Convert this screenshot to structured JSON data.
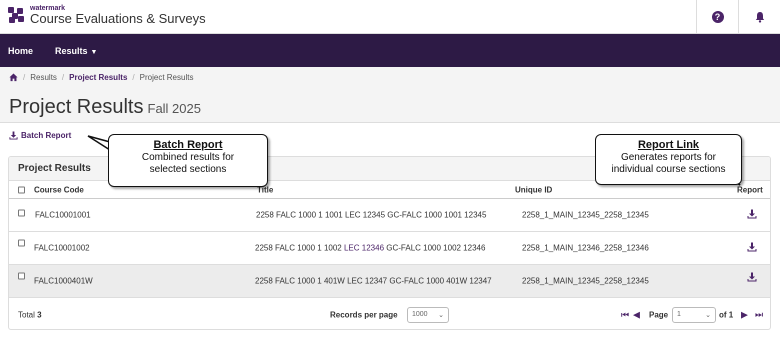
{
  "app": {
    "brand_small": "watermark",
    "brand_name": "Course Evaluations & Surveys"
  },
  "nav": {
    "home": "Home",
    "results": "Results"
  },
  "breadcrumb": {
    "items": [
      "Results",
      "Project Results",
      "Project Results"
    ]
  },
  "page": {
    "title": "Project Results",
    "term": "Fall 2025"
  },
  "batch_report_label": "Batch Report",
  "panel": {
    "title": "Project Results",
    "columns": {
      "course_code": "Course Code",
      "title": "Title",
      "unique_id": "Unique ID",
      "report": "Report"
    },
    "rows": [
      {
        "course_code": "FALC10001001",
        "title_start": "2258 FALC 1000 1 1001",
        "title_lec": "LEC 12345",
        "title_end": "GC-FALC 1000 1001 12345",
        "unique_id": "2258_1_MAIN_12345_2258_12345"
      },
      {
        "course_code": "FALC10001002",
        "title_start": "2258 FALC 1000 1 1002",
        "title_lec": "LEC 12346",
        "title_end": "GC-FALC 1000 1002 12346",
        "unique_id": "2258_1_MAIN_12346_2258_12346"
      },
      {
        "course_code": "FALC1000401W",
        "title_start": "2258 FALC 1000 1 401W",
        "title_lec": "LEC 12347",
        "title_end": "GC-FALC 1000 401W 12347",
        "unique_id": "2258_1_MAIN_12345_2258_12345"
      }
    ],
    "footer": {
      "total_label": "Total",
      "total_value": "3",
      "records_per_page_label": "Records per page",
      "records_per_page_value": "1000",
      "page_label": "Page",
      "page_value": "1",
      "of_label": "of",
      "page_count": "1"
    }
  },
  "callouts": {
    "batch": {
      "heading": "Batch Report",
      "line1": "Combined results for",
      "line2": "selected sections"
    },
    "report_link": {
      "heading": "Report Link",
      "line1": "Generates reports for",
      "line2": "individual course sections"
    }
  },
  "colors": {
    "brand_purple": "#4b2468",
    "navbar": "#2d1a45"
  }
}
